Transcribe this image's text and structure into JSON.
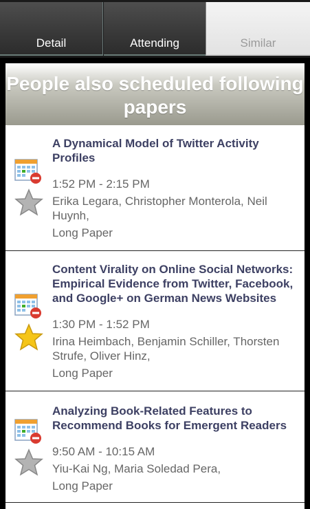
{
  "tabs": [
    {
      "label": "Detail",
      "active": false
    },
    {
      "label": "Attending",
      "active": false
    },
    {
      "label": "Similar",
      "active": true
    }
  ],
  "header": {
    "title": "People also scheduled following papers"
  },
  "papers": [
    {
      "title": "A Dynamical Model of Twitter Activity Profiles",
      "time": "1:52 PM - 2:15 PM",
      "authors": "Erika Legara, Christopher Monterola, Neil Huynh,",
      "type": "Long Paper",
      "starred": false
    },
    {
      "title": "Content Virality on Online Social Networks: Empirical Evidence from Twitter, Facebook, and Google+ on German News Websites",
      "time": "1:30 PM - 1:52 PM",
      "authors": "Irina Heimbach, Benjamin Schiller, Thorsten Strufe, Oliver Hinz,",
      "type": "Long Paper",
      "starred": true
    },
    {
      "title": "Analyzing Book-Related Features to Recommend Books for Emergent Readers",
      "time": "9:50 AM - 10:15 AM",
      "authors": "Yiu-Kai Ng, Maria Soledad Pera,",
      "type": "Long Paper",
      "starred": false
    }
  ],
  "icons": {
    "calendar": "calendar-remove-icon",
    "star": "star-icon"
  },
  "colors": {
    "title": "#3d4063",
    "meta": "#666666",
    "star_on": "#f5c518",
    "star_off": "#a9a9a9",
    "remove": "#d93b30"
  }
}
